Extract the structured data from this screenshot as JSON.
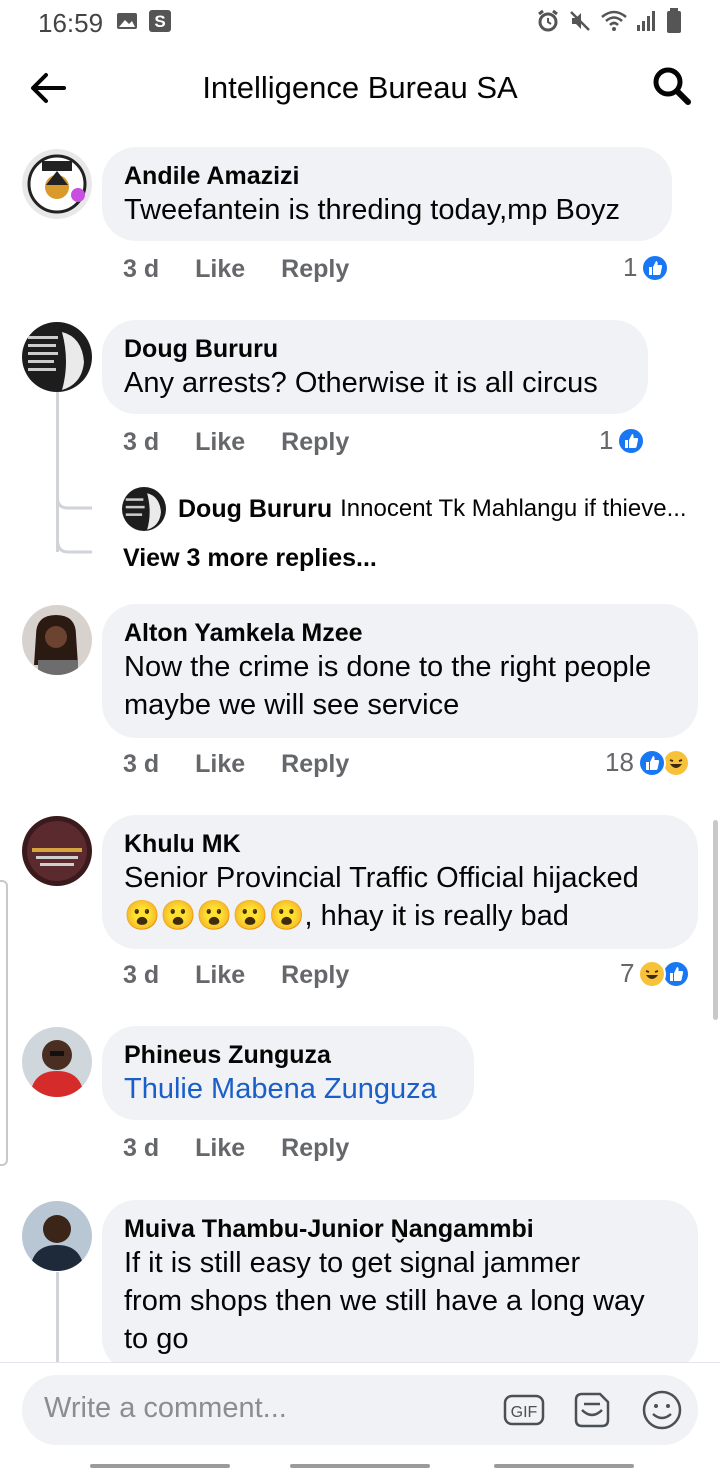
{
  "status_bar": {
    "time": "16:59",
    "left_icons": [
      "image-icon",
      "s-app-icon"
    ],
    "right_icons": [
      "alarm-icon",
      "mute-icon",
      "wifi-icon",
      "signal-icon",
      "battery-icon"
    ]
  },
  "header": {
    "title": "Intelligence Bureau SA"
  },
  "comments": [
    {
      "author": "Andile Amazizi",
      "text": "Tweefantein is threding today,mp Boyz",
      "time": "3 d",
      "like": "Like",
      "reply": "Reply",
      "reaction_count": "1",
      "reactions": [
        "like"
      ]
    },
    {
      "author": "Doug Bururu",
      "text": "Any arrests? Otherwise it is all circus",
      "time": "3 d",
      "like": "Like",
      "reply": "Reply",
      "reaction_count": "1",
      "reactions": [
        "like"
      ],
      "reply_preview": {
        "author": "Doug Bururu",
        "text": "Innocent Tk Mahlangu if thieve..."
      },
      "view_more": "View 3 more replies..."
    },
    {
      "author": "Alton Yamkela Mzee",
      "text_lines": [
        "Now the crime is done to the right people",
        "maybe we will  see service"
      ],
      "time": "3 d",
      "like": "Like",
      "reply": "Reply",
      "reaction_count": "18",
      "reactions": [
        "like",
        "haha"
      ]
    },
    {
      "author": "Khulu MK",
      "text_line1": "Senior Provincial Traffic Official hijacked",
      "text_line2": ", hhay it is really bad",
      "emojis": [
        "😮",
        "😮",
        "😮",
        "😮",
        "😮"
      ],
      "time": "3 d",
      "like": "Like",
      "reply": "Reply",
      "reaction_count": "7",
      "reactions": [
        "haha",
        "like"
      ]
    },
    {
      "author": "Phineus Zunguza",
      "text": "Thulie Mabena Zunguza",
      "time": "3 d",
      "like": "Like",
      "reply": "Reply"
    },
    {
      "author": "Muiva Thambu-Junior N̬angammbi",
      "text_lines": [
        "If it is still easy to get signal jammer",
        "from shops then we still have a long way",
        "to go"
      ]
    }
  ],
  "composer": {
    "placeholder": "Write a comment...",
    "gif_label": "GIF"
  },
  "colors": {
    "bubble": "#f0f2f5",
    "like_blue": "#1877f2",
    "link_blue": "#1a5ec8",
    "meta_gray": "#65676b"
  }
}
